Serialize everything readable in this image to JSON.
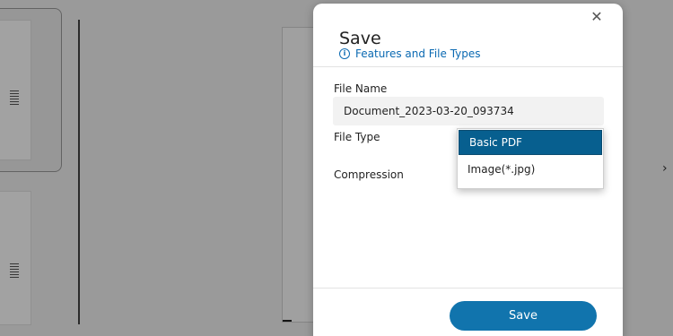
{
  "dialog": {
    "title": "Save",
    "features_link": "Features and File Types",
    "close_glyph": "✕",
    "file_name_label": "File Name",
    "file_name_value": "Document_2023-03-20_093734",
    "file_type_label": "File Type",
    "compression_label": "Compression",
    "file_type_options": [
      {
        "label": "Basic PDF",
        "selected": true
      },
      {
        "label": "Image(*.jpg)",
        "selected": false
      }
    ],
    "save_label": "Save"
  },
  "colors": {
    "accent": "#1174ad",
    "selected_option": "#075f8f",
    "link": "#0a69b2"
  }
}
